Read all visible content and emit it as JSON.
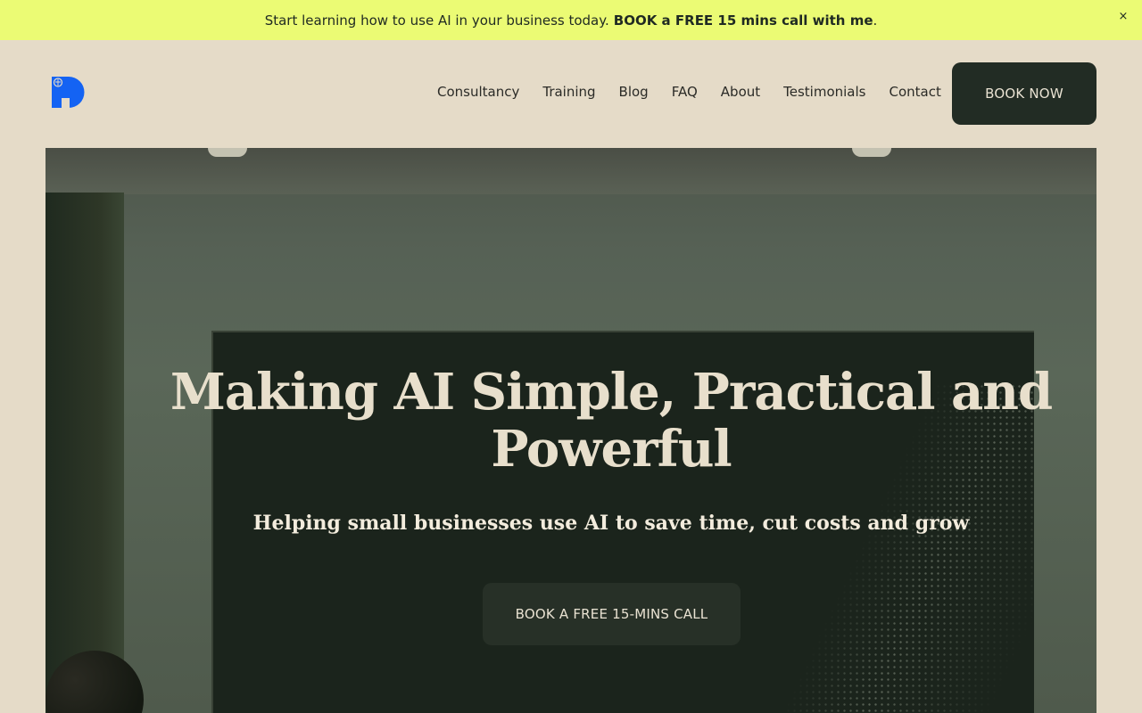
{
  "announcement": {
    "text": "Start learning how to use AI in your business today.",
    "link_text": "BOOK a FREE 15 mins call with me",
    "trailing": ".",
    "close_label": "×"
  },
  "header": {
    "nav": [
      {
        "label": "Consultancy"
      },
      {
        "label": "Training"
      },
      {
        "label": "Blog"
      },
      {
        "label": "FAQ"
      },
      {
        "label": "About"
      },
      {
        "label": "Testimonials"
      },
      {
        "label": "Contact"
      }
    ],
    "book_now": "BOOK NOW"
  },
  "hero": {
    "title": "Making AI Simple, Practical and Powerful",
    "subtitle": "Helping small businesses use AI to save time, cut costs and grow",
    "cta": "BOOK A FREE 15-MINS CALL"
  },
  "colors": {
    "announcement_bg": "#ebfb74",
    "page_bg": "#e5dbc8",
    "button_bg": "#222c24",
    "logo_blue": "#1463f3"
  },
  "icons": {
    "logo": "p-logo-icon",
    "close": "close-icon"
  }
}
